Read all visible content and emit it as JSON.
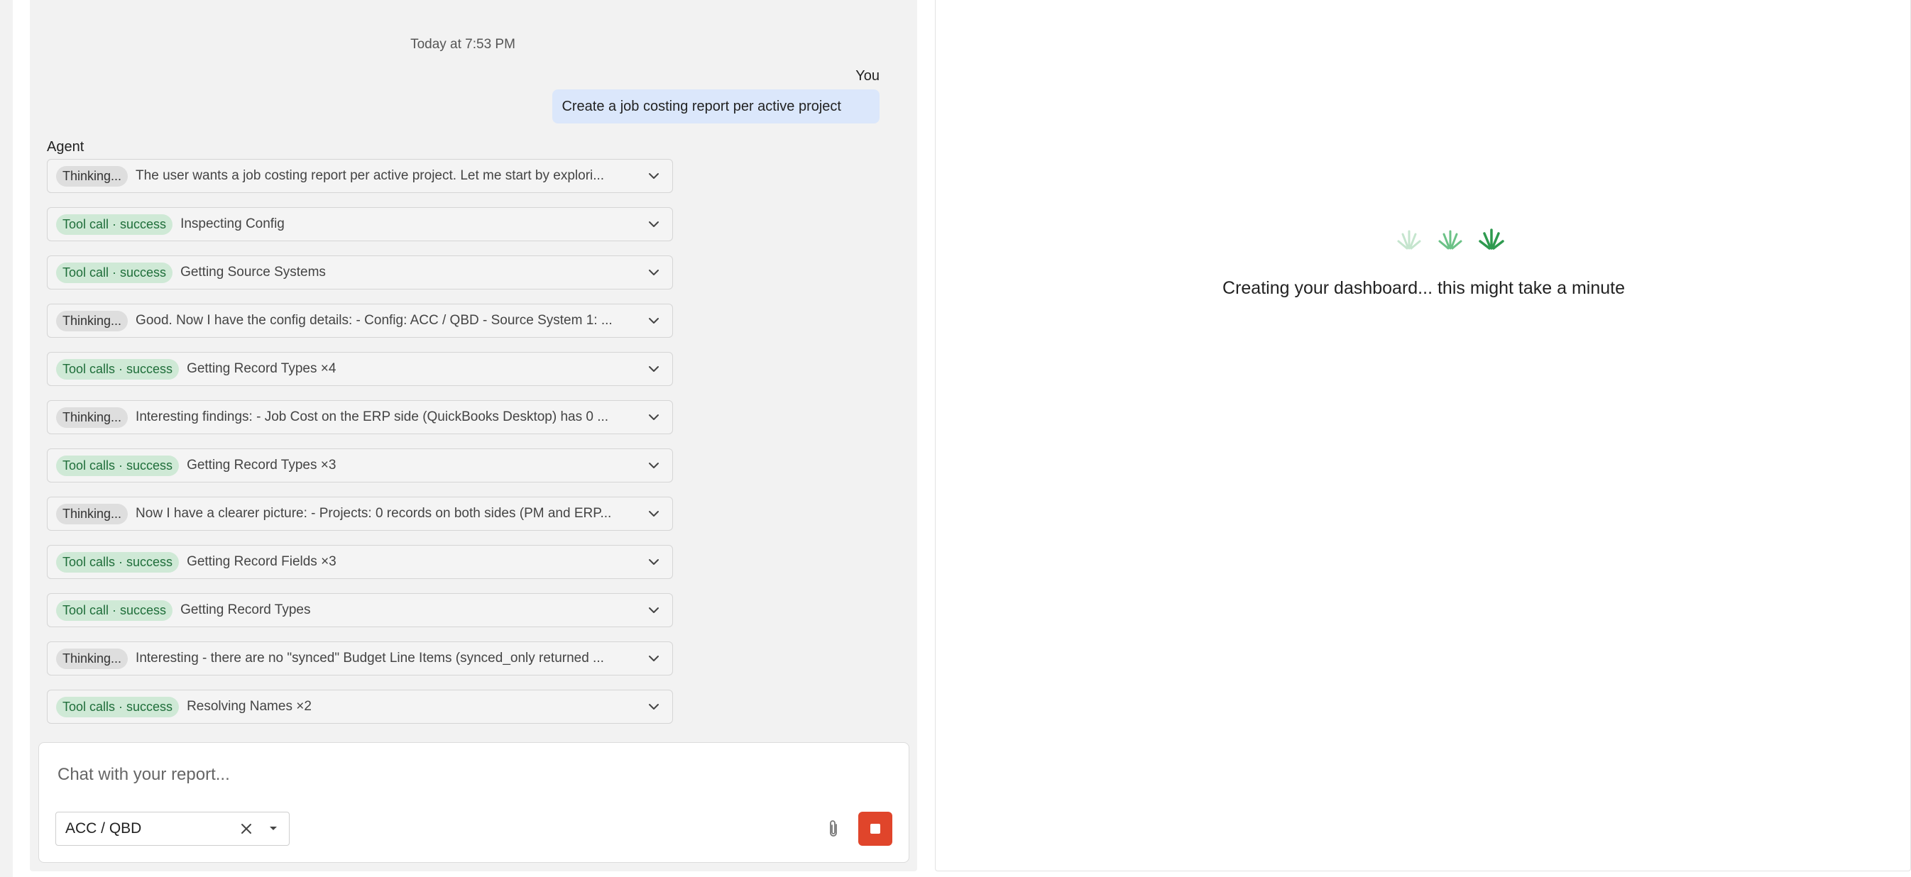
{
  "chat": {
    "timestamp": "Today at 7:53 PM",
    "user_label": "You",
    "user_message": "Create a job costing report per active project",
    "agent_label": "Agent",
    "steps": [
      {
        "badge": "Thinking...",
        "status": "thinking",
        "text": "The user wants a job costing report per active project. Let me start by explori..."
      },
      {
        "badge": "Tool call · success",
        "status": "success",
        "text": "Inspecting Config"
      },
      {
        "badge": "Tool call · success",
        "status": "success",
        "text": "Getting Source Systems"
      },
      {
        "badge": "Thinking...",
        "status": "thinking",
        "text": "Good. Now I have the config details: - Config: ACC / QBD - Source System 1: ..."
      },
      {
        "badge": "Tool calls · success",
        "status": "success",
        "text": "Getting Record Types ×4"
      },
      {
        "badge": "Thinking...",
        "status": "thinking",
        "text": "Interesting findings: - Job Cost on the ERP side (QuickBooks Desktop) has 0 ..."
      },
      {
        "badge": "Tool calls · success",
        "status": "success",
        "text": "Getting Record Types ×3"
      },
      {
        "badge": "Thinking...",
        "status": "thinking",
        "text": "Now I have a clearer picture: - Projects: 0 records on both sides (PM and ERP..."
      },
      {
        "badge": "Tool calls · success",
        "status": "success",
        "text": "Getting Record Fields ×3"
      },
      {
        "badge": "Tool call · success",
        "status": "success",
        "text": "Getting Record Types"
      },
      {
        "badge": "Thinking...",
        "status": "thinking",
        "text": "Interesting - there are no \"synced\" Budget Line Items (synced_only returned ..."
      },
      {
        "badge": "Tool calls · success",
        "status": "success",
        "text": "Resolving Names ×2"
      }
    ]
  },
  "composer": {
    "placeholder": "Chat with your report...",
    "source_value": "ACC / QBD",
    "icons": {
      "clear": "close-icon",
      "caret": "caret-down-icon",
      "attach": "paperclip-icon",
      "stop": "stop-icon"
    }
  },
  "dashboard": {
    "loading_text": "Creating your dashboard... this might take a minute"
  },
  "colors": {
    "accent_green": "#2e9a4f",
    "success_badge_bg": "#cfe9d6",
    "thinking_badge_bg": "#dedede",
    "user_bubble_bg": "#dbe7fb",
    "stop_button": "#e0452b"
  }
}
